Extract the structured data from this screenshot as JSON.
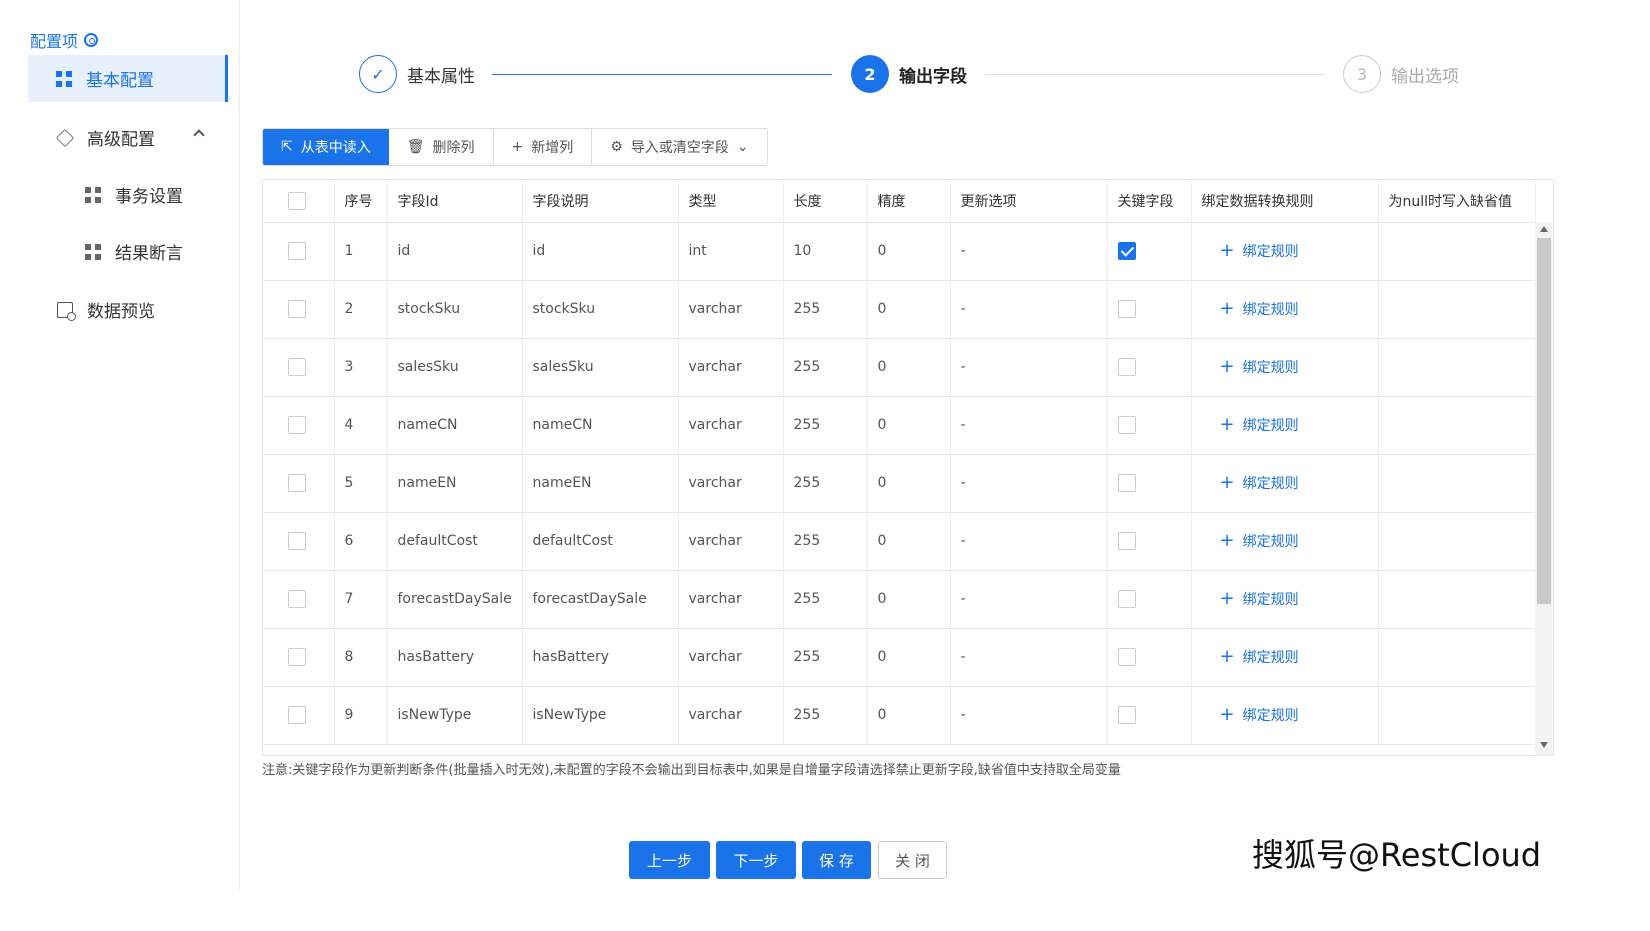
{
  "sidebar": {
    "title": "配置项",
    "items": [
      {
        "label": "基本配置"
      },
      {
        "label": "高级配置"
      },
      {
        "label": "事务设置"
      },
      {
        "label": "结果断言"
      },
      {
        "label": "数据预览"
      }
    ]
  },
  "steps": [
    {
      "label": "基本属性",
      "marker": "✓",
      "state": "done"
    },
    {
      "label": "输出字段",
      "marker": "2",
      "state": "active"
    },
    {
      "label": "输出选项",
      "marker": "3",
      "state": "todo"
    }
  ],
  "toolbar": {
    "read_from_table": "从表中读入",
    "delete_column": "删除列",
    "add_column": "新增列",
    "import_or_clear": "导入或清空字段"
  },
  "table": {
    "headers": [
      "序号",
      "字段Id",
      "字段说明",
      "类型",
      "长度",
      "精度",
      "更新选项",
      "关键字段",
      "绑定数据转换规则",
      "为null时写入缺省值"
    ],
    "bind_label": "绑定规则",
    "rows": [
      {
        "no": "1",
        "field_id": "id",
        "desc": "id",
        "type": "int",
        "length": "10",
        "precision": "0",
        "update": "-",
        "key": true
      },
      {
        "no": "2",
        "field_id": "stockSku",
        "desc": "stockSku",
        "type": "varchar",
        "length": "255",
        "precision": "0",
        "update": "-",
        "key": false
      },
      {
        "no": "3",
        "field_id": "salesSku",
        "desc": "salesSku",
        "type": "varchar",
        "length": "255",
        "precision": "0",
        "update": "-",
        "key": false
      },
      {
        "no": "4",
        "field_id": "nameCN",
        "desc": "nameCN",
        "type": "varchar",
        "length": "255",
        "precision": "0",
        "update": "-",
        "key": false
      },
      {
        "no": "5",
        "field_id": "nameEN",
        "desc": "nameEN",
        "type": "varchar",
        "length": "255",
        "precision": "0",
        "update": "-",
        "key": false
      },
      {
        "no": "6",
        "field_id": "defaultCost",
        "desc": "defaultCost",
        "type": "varchar",
        "length": "255",
        "precision": "0",
        "update": "-",
        "key": false
      },
      {
        "no": "7",
        "field_id": "forecastDaySale",
        "desc": "forecastDaySale",
        "type": "varchar",
        "length": "255",
        "precision": "0",
        "update": "-",
        "key": false
      },
      {
        "no": "8",
        "field_id": "hasBattery",
        "desc": "hasBattery",
        "type": "varchar",
        "length": "255",
        "precision": "0",
        "update": "-",
        "key": false
      },
      {
        "no": "9",
        "field_id": "isNewType",
        "desc": "isNewType",
        "type": "varchar",
        "length": "255",
        "precision": "0",
        "update": "-",
        "key": false
      }
    ]
  },
  "note": "注意:关键字段作为更新判断条件(批量插入时无效),未配置的字段不会输出到目标表中,如果是自增量字段请选择禁止更新字段,缺省值中支持取全局变量",
  "footer": {
    "prev": "上一步",
    "next": "下一步",
    "save": "保 存",
    "close": "关 闭"
  },
  "watermark": "搜狐号@RestCloud",
  "colors": {
    "primary": "#1a73e8",
    "active_bg": "#e6f1fd"
  }
}
